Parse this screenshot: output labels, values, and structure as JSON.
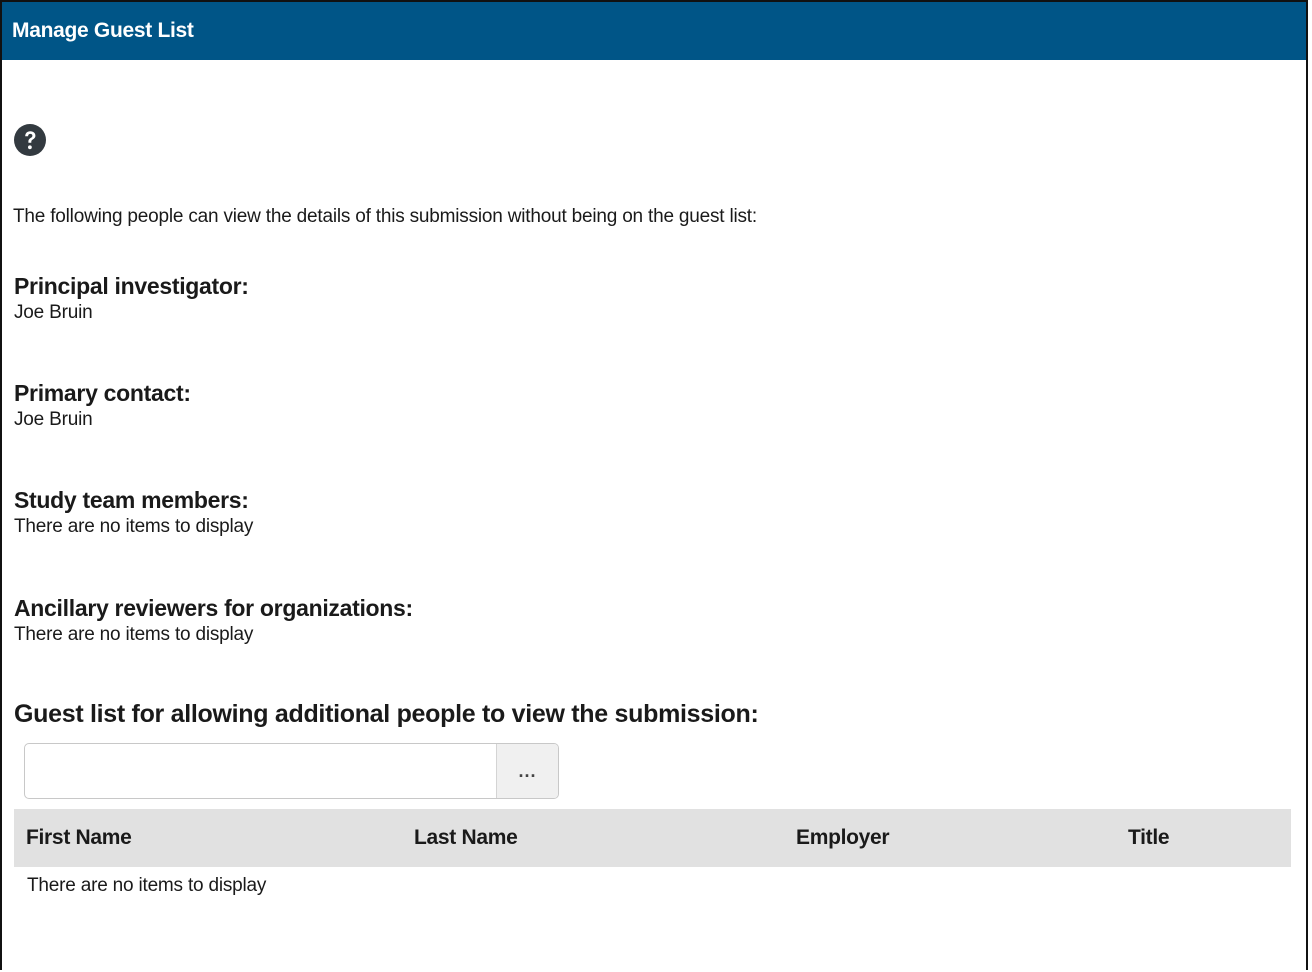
{
  "header": {
    "title": "Manage Guest List"
  },
  "help_icon": "question-circle-icon",
  "intro_text": "The following people can view the details of this submission without being on the guest list:",
  "sections": {
    "principal_investigator": {
      "title": "Principal investigator:",
      "value": "Joe Bruin"
    },
    "primary_contact": {
      "title": "Primary contact:",
      "value": "Joe Bruin"
    },
    "study_team_members": {
      "title": "Study team members:",
      "value": "There are no items to display"
    },
    "ancillary_reviewers": {
      "title": "Ancillary reviewers for organizations:",
      "value": "There are no items to display"
    }
  },
  "guest_list": {
    "title": "Guest list for allowing additional people to view the submission:",
    "search_value": "",
    "browse_label": "...",
    "columns": [
      "First Name",
      "Last Name",
      "Employer",
      "Title"
    ],
    "empty_message": "There are no items to display"
  },
  "colors": {
    "header_bg": "#005587",
    "table_header_bg": "#e1e1e1"
  }
}
